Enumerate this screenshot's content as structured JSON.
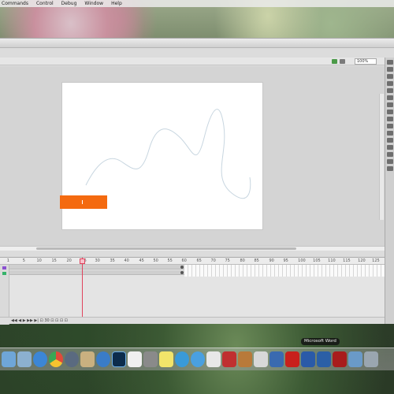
{
  "menubar": {
    "items": [
      "Commands",
      "Control",
      "Debug",
      "Window",
      "Help"
    ]
  },
  "editbar": {
    "zoom": "100%"
  },
  "timeline": {
    "ruler_ticks": [
      "1",
      "5",
      "10",
      "15",
      "20",
      "25",
      "30",
      "35",
      "40",
      "45",
      "50",
      "55",
      "60",
      "65",
      "70",
      "75",
      "80",
      "85",
      "90",
      "95",
      "100",
      "105",
      "110",
      "115",
      "120",
      "125"
    ],
    "bottom_text": "◀◀ ◀ ▶ ▶▶ ▶| ⊡ 30 ⊡ ⊡ ⊡ ⊡"
  },
  "dock": {
    "tooltip": "Microsoft Word",
    "icons": [
      "finder",
      "preview",
      "safari",
      "chrome",
      "itunes-old",
      "notes",
      "safari-compass",
      "photoshop",
      "calendar",
      "system-prefs",
      "stickies",
      "app-store",
      "itunes",
      "textedit",
      "terminal",
      "calculator",
      "home",
      "browser",
      "flash",
      "adobe-app",
      "word",
      "acrobat",
      "downloads",
      "trash"
    ]
  }
}
